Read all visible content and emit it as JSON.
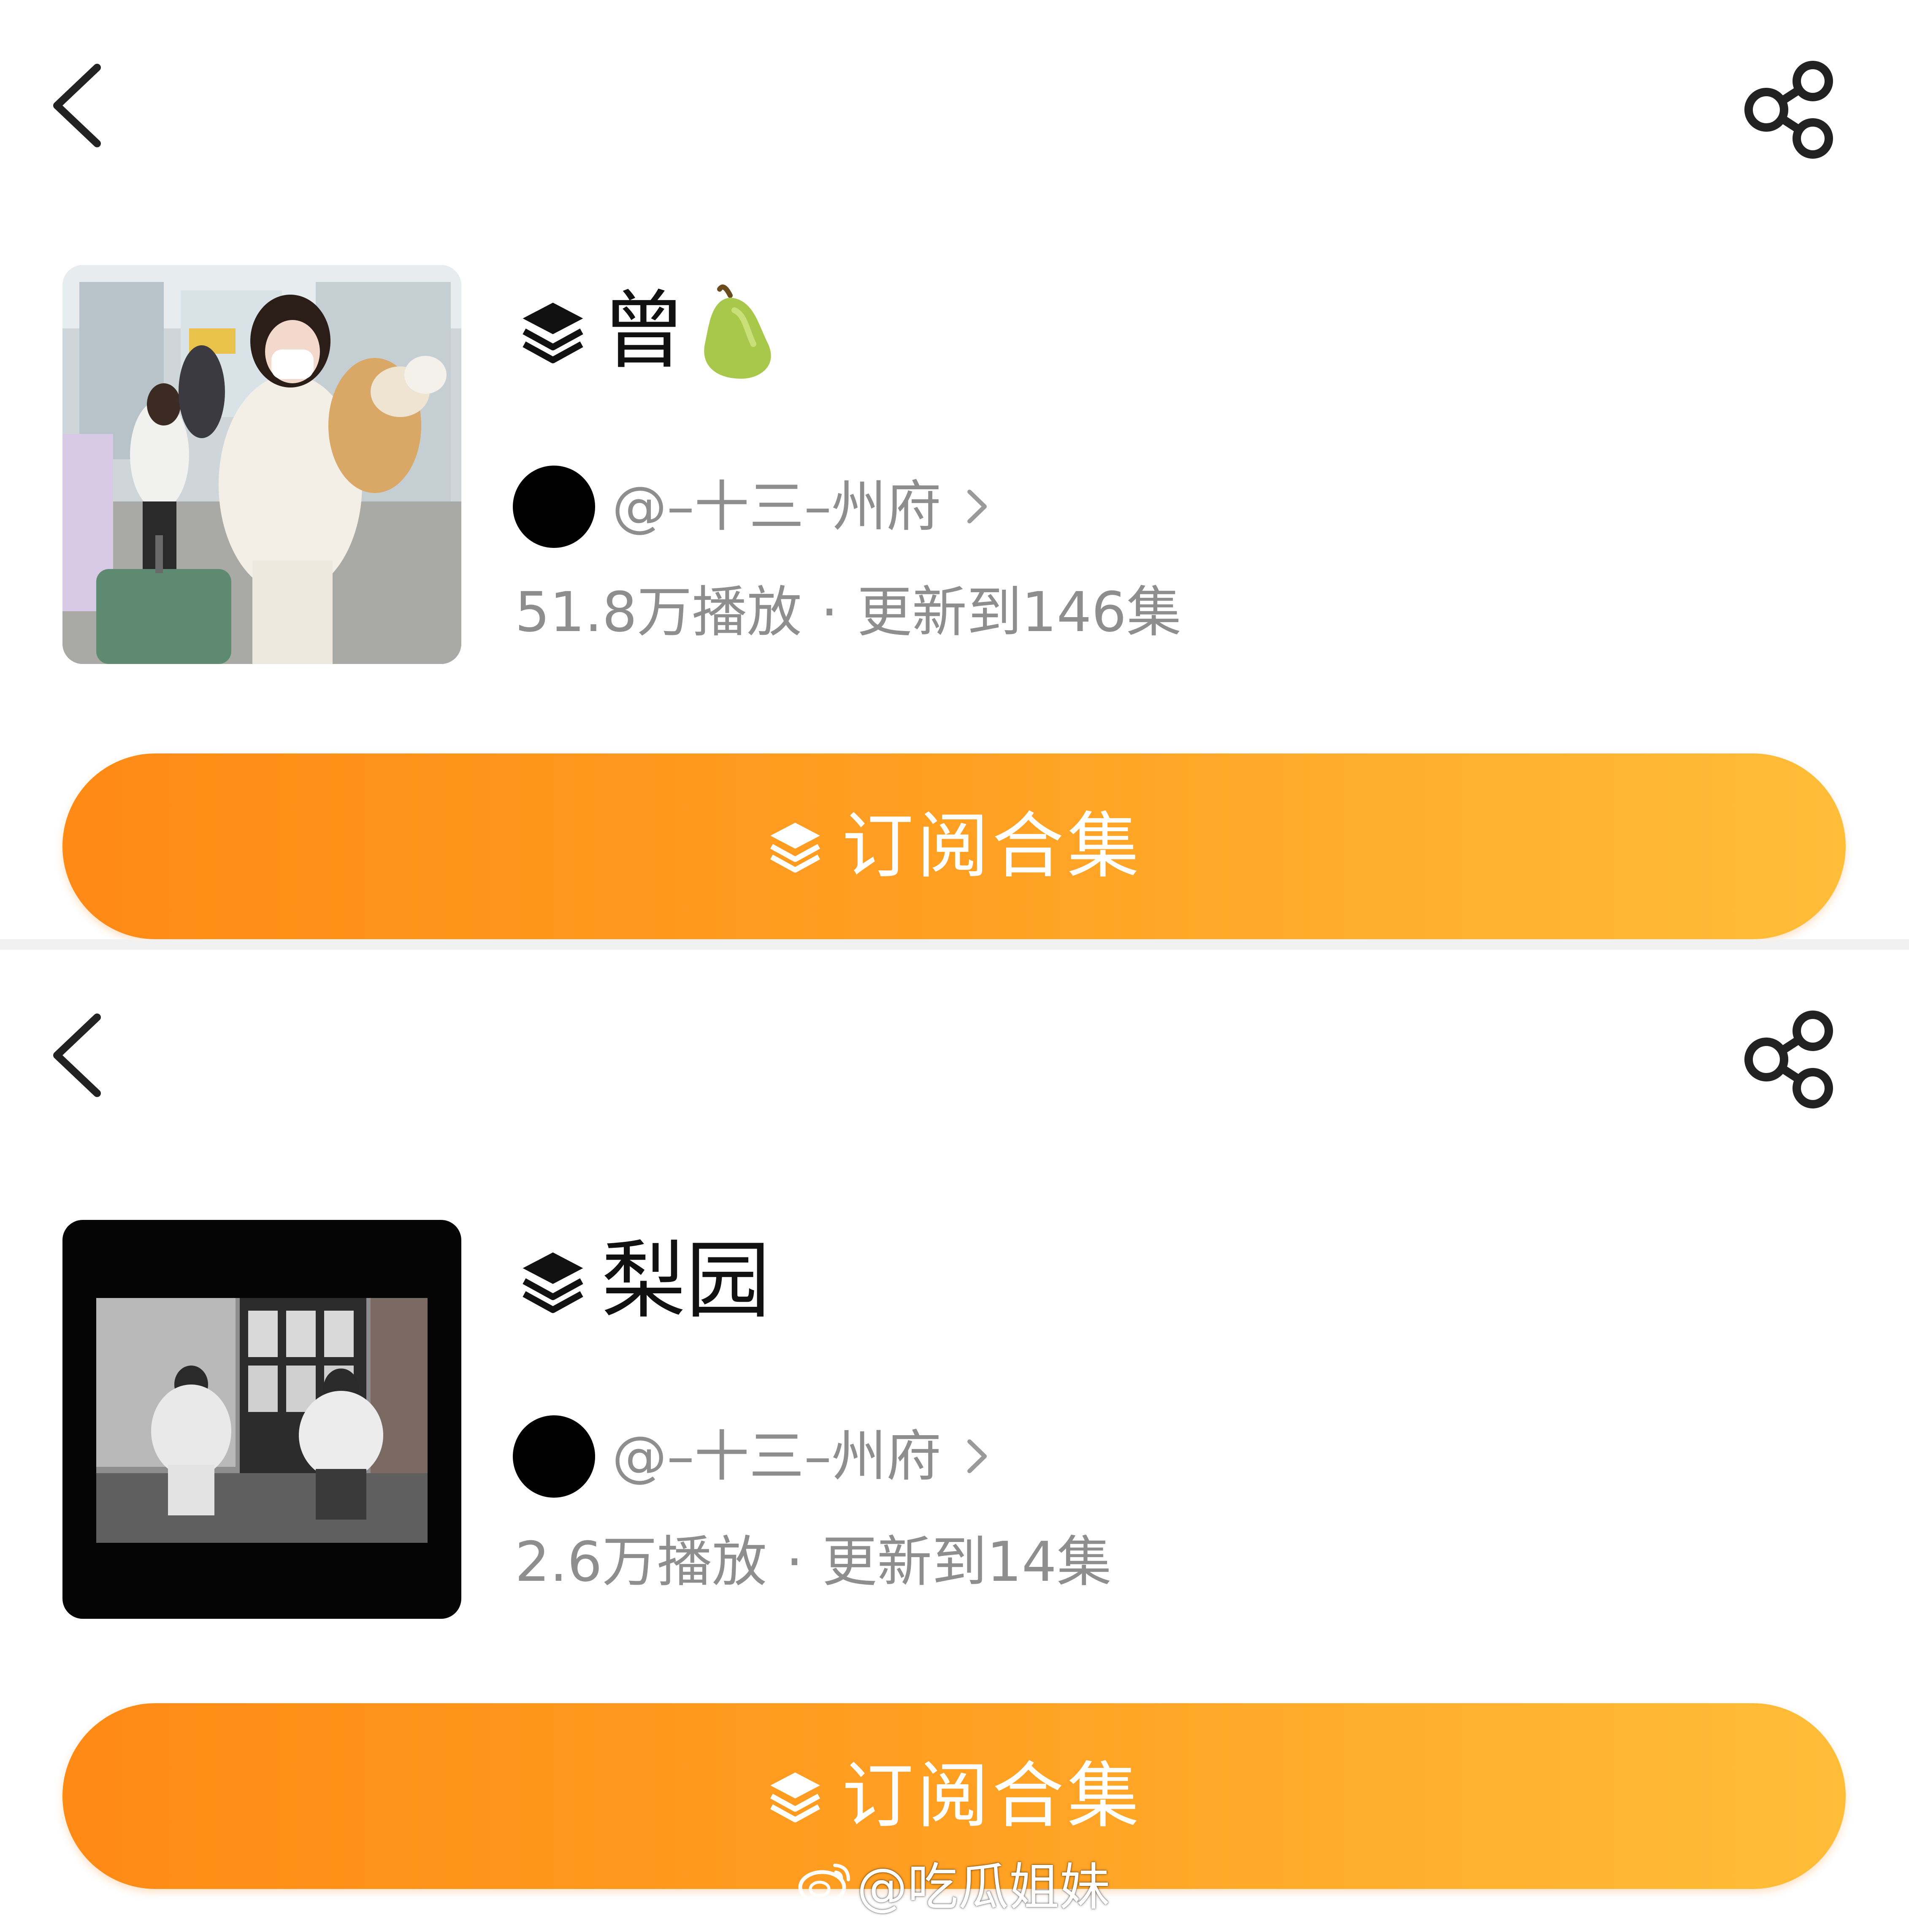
{
  "collections": [
    {
      "title": "曾",
      "author": "@–十三–州府",
      "plays": "51.8万播放",
      "separator": "·",
      "updated": "更新到146集",
      "subscribe_label": "订阅合集",
      "title_icon": "pear-icon"
    },
    {
      "title": "梨园",
      "author": "@–十三–州府",
      "plays": "2.6万播放",
      "separator": "·",
      "updated": "更新到14集",
      "subscribe_label": "订阅合集"
    }
  ],
  "watermark": {
    "text": "@吃瓜姐妹",
    "icon": "weibo-logo-icon"
  },
  "colors": {
    "button_start": "#ff8a15",
    "button_end": "#ffbd38",
    "meta_text": "#8e8e8e"
  }
}
